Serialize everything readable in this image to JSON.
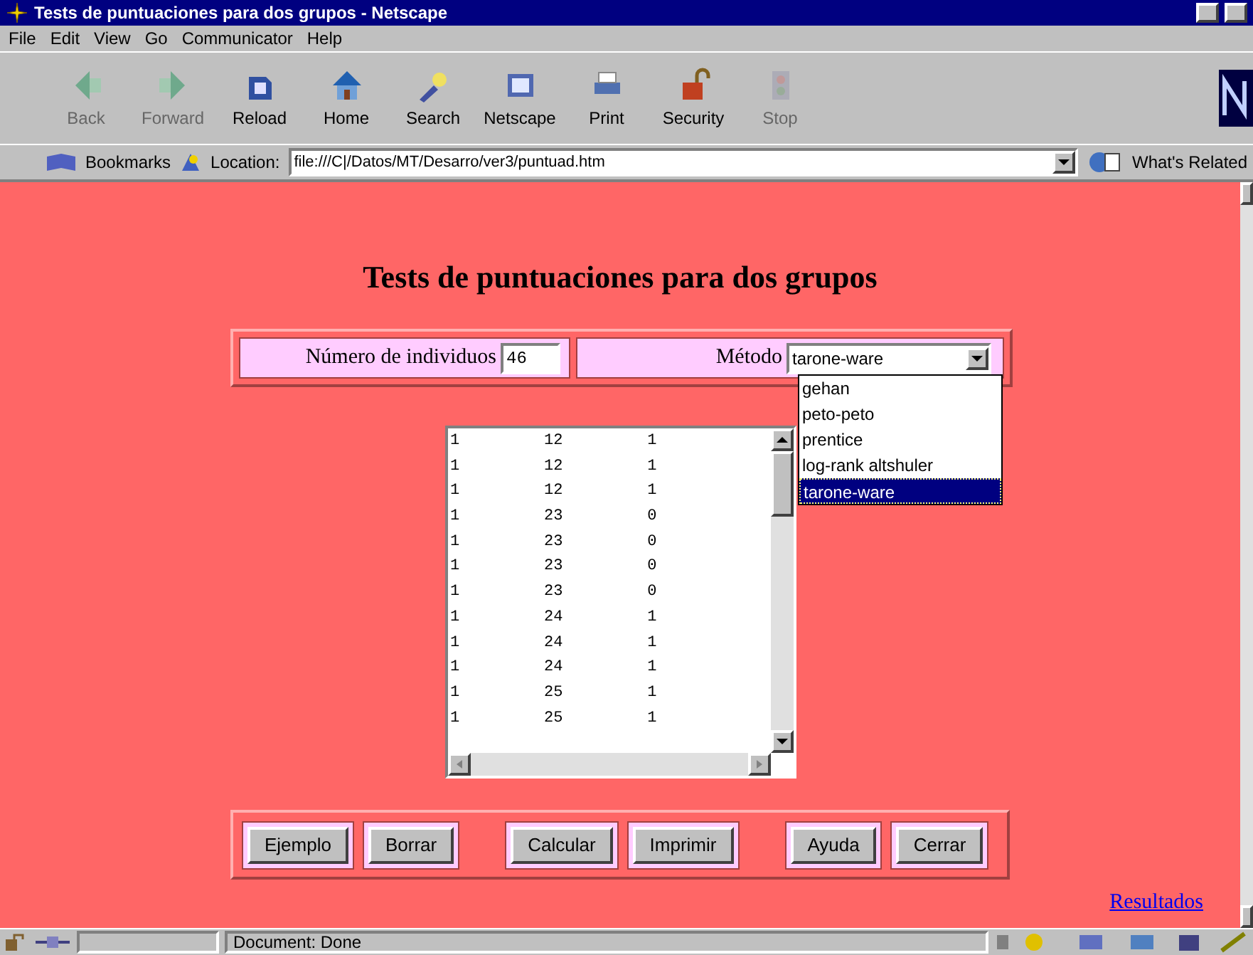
{
  "window": {
    "title": "Tests de puntuaciones para dos grupos - Netscape"
  },
  "menu": [
    "File",
    "Edit",
    "View",
    "Go",
    "Communicator",
    "Help"
  ],
  "toolbar": [
    {
      "label": "Back",
      "kind": "back",
      "disabled": true
    },
    {
      "label": "Forward",
      "kind": "forward",
      "disabled": true
    },
    {
      "label": "Reload",
      "kind": "reload",
      "disabled": false
    },
    {
      "label": "Home",
      "kind": "home",
      "disabled": false
    },
    {
      "label": "Search",
      "kind": "search",
      "disabled": false
    },
    {
      "label": "Netscape",
      "kind": "netscape",
      "disabled": false
    },
    {
      "label": "Print",
      "kind": "print",
      "disabled": false
    },
    {
      "label": "Security",
      "kind": "security",
      "disabled": false
    },
    {
      "label": "Stop",
      "kind": "stop",
      "disabled": true
    }
  ],
  "location_bar": {
    "bookmarks": "Bookmarks",
    "location_label": "Location:",
    "url": "file:///C|/Datos/MT/Desarro/ver3/puntuad.htm",
    "related": "What's Related"
  },
  "page": {
    "heading": "Tests de puntuaciones para dos grupos",
    "count_label": "Número de individuos",
    "count_value": "46",
    "method_label": "Método",
    "method_value": "tarone-ware",
    "method_options": [
      {
        "label": "gehan",
        "selected": false
      },
      {
        "label": "peto-peto",
        "selected": false
      },
      {
        "label": "prentice",
        "selected": false
      },
      {
        "label": "log-rank altshuler",
        "selected": false
      },
      {
        "label": "tarone-ware",
        "selected": true
      }
    ],
    "data_lines": [
      "1         12         1",
      "1         12         1",
      "1         12         1",
      "1         23         0",
      "1         23         0",
      "1         23         0",
      "1         23         0",
      "1         24         1",
      "1         24         1",
      "1         24         1",
      "1         25         1",
      "1         25         1"
    ],
    "button_groups": [
      [
        "Ejemplo",
        "Borrar"
      ],
      [
        "Calcular",
        "Imprimir"
      ],
      [
        "Ayuda",
        "Cerrar"
      ]
    ],
    "link": "Resultados"
  },
  "status_bar": {
    "text": "Document: Done"
  }
}
